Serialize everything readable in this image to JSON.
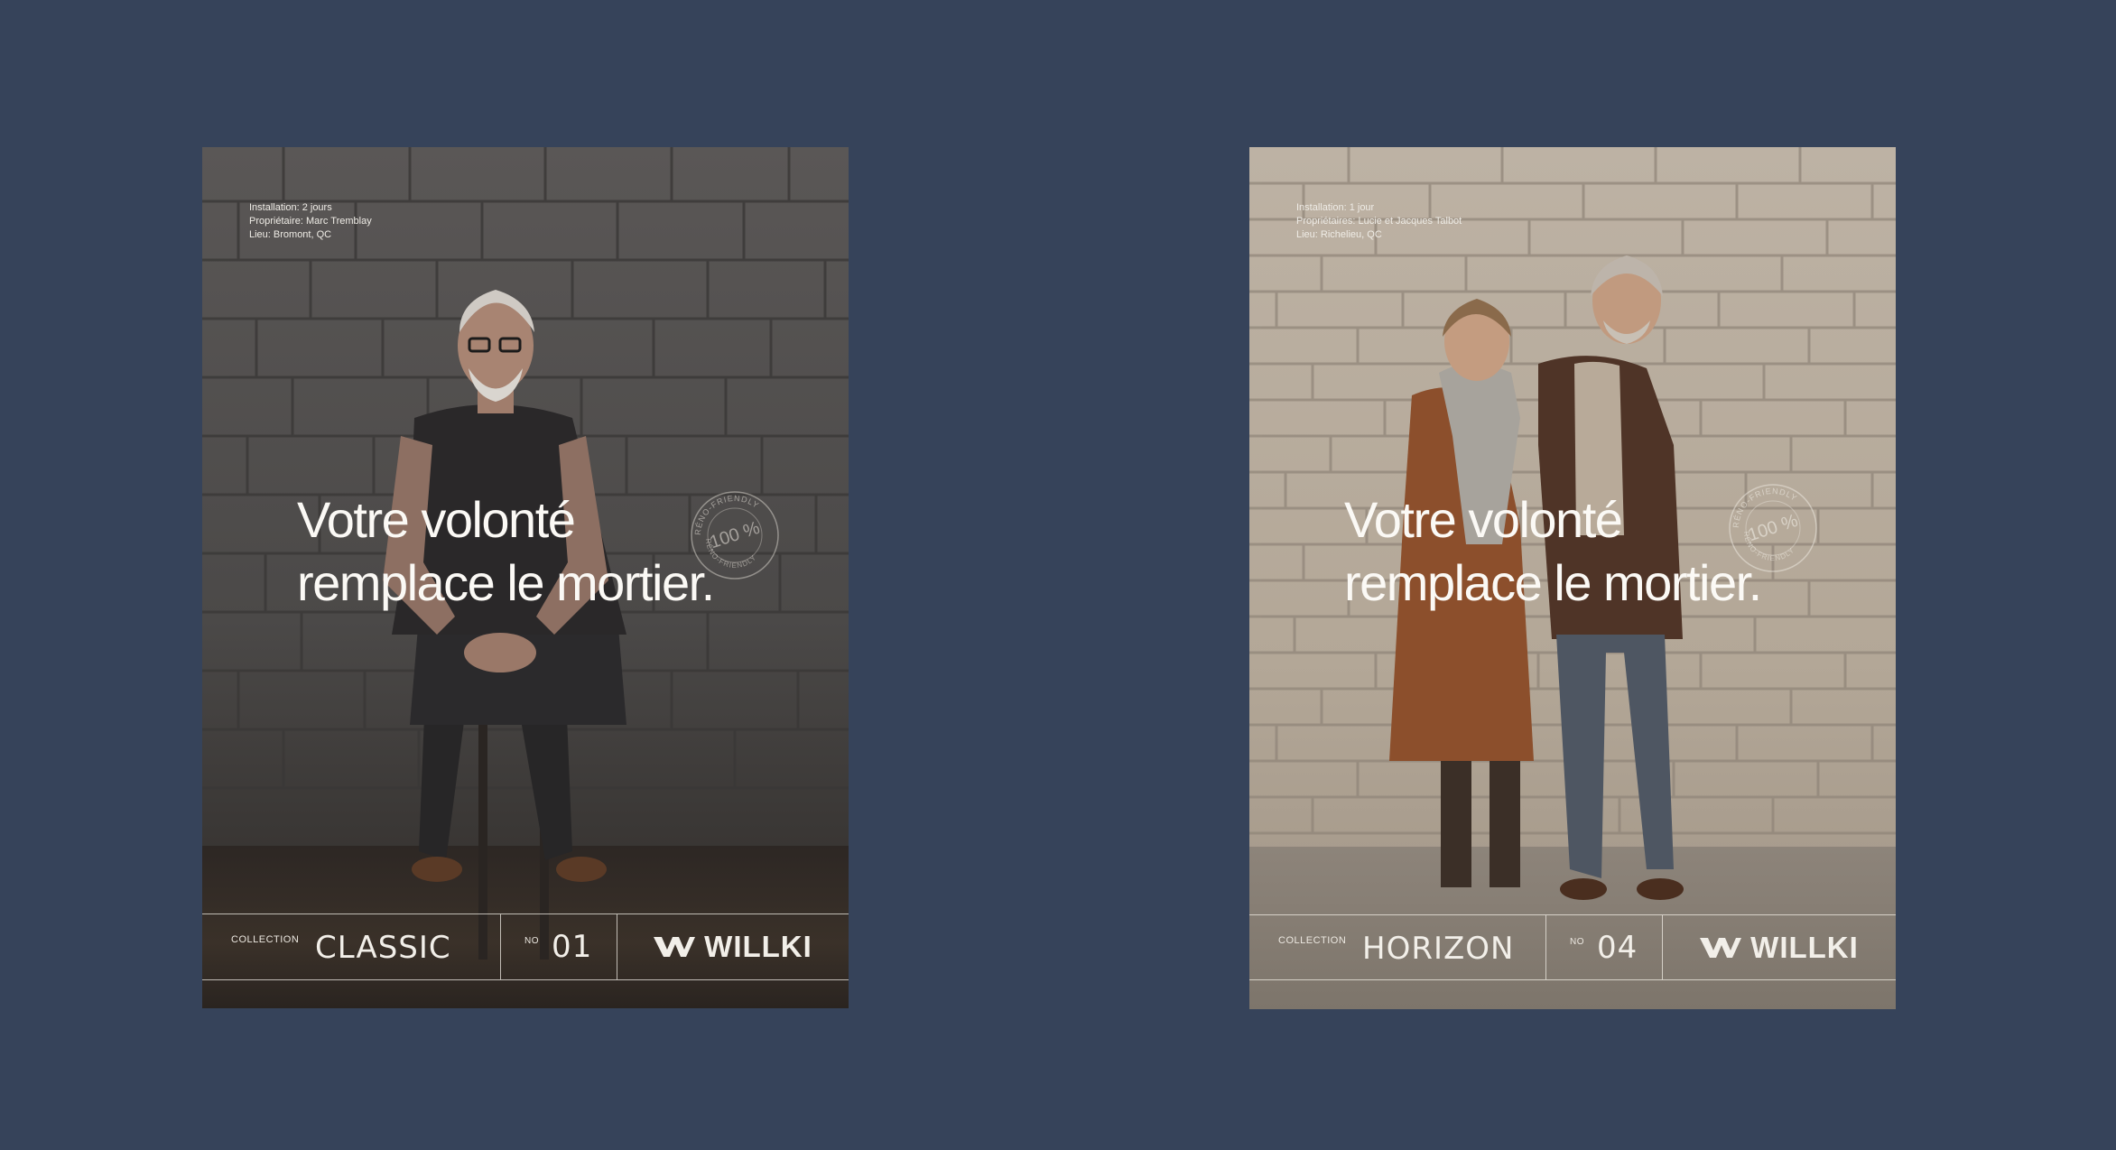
{
  "posters": [
    {
      "info": {
        "line1": "Installation: 2 jours",
        "line2": "Propriétaire: Marc Tremblay",
        "line3": "Lieu: Bromont, QC"
      },
      "headline": {
        "line1": "Votre volonté",
        "line2": "remplace le mortier."
      },
      "stamp": {
        "top": "RÉNO-FRIENDLY",
        "center": "100 %",
        "bottom": "RÉNO-FRIENDLY"
      },
      "collection_label": "COLLECTION",
      "collection_name": "CLASSIC",
      "number_label": "NO",
      "number_value": "01",
      "brand": "WILLKI"
    },
    {
      "info": {
        "line1": "Installation: 1 jour",
        "line2": "Propriétaires: Lucie et Jacques Talbot",
        "line3": "Lieu: Richelieu, QC"
      },
      "headline": {
        "line1": "Votre volonté",
        "line2": "remplace le mortier."
      },
      "stamp": {
        "top": "RÉNO-FRIENDLY",
        "center": "100 %",
        "bottom": "RÉNO-FRIENDLY"
      },
      "collection_label": "COLLECTION",
      "collection_name": "HORIZON",
      "number_label": "NO",
      "number_value": "04",
      "brand": "WILLKI"
    }
  ],
  "colors": {
    "page_background": "#36435a",
    "poster1_wall": "#4f4c4b",
    "poster2_wall": "#b3a797",
    "text": "#f2efe9"
  }
}
